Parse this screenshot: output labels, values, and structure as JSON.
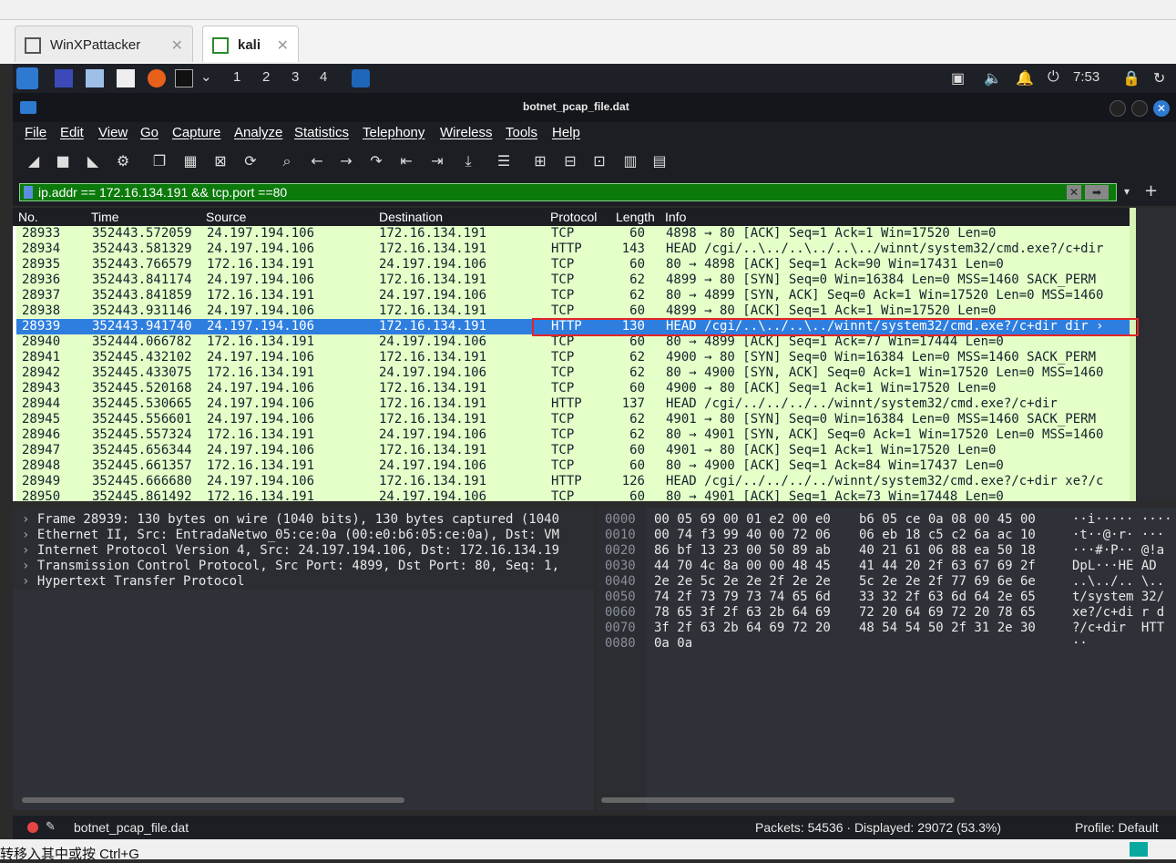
{
  "vm_tabs": [
    {
      "label": "WinXPattacker"
    },
    {
      "label": "kali"
    }
  ],
  "panel": {
    "workspaces": [
      "1",
      "2",
      "3",
      "4"
    ],
    "clock": "7:53"
  },
  "window": {
    "title": "botnet_pcap_file.dat"
  },
  "menu": {
    "items": [
      "File",
      "Edit",
      "View",
      "Go",
      "Capture",
      "Analyze",
      "Statistics",
      "Telephony",
      "Wireless",
      "Tools",
      "Help"
    ]
  },
  "filter": {
    "value": "ip.addr == 172.16.134.191 && tcp.port ==80"
  },
  "packet_list": {
    "columns": [
      "No.",
      "Time",
      "Source",
      "Destination",
      "Protocol",
      "Length",
      "Info"
    ],
    "rows": [
      {
        "no": "28933",
        "time": "352443.572059",
        "src": "24.197.194.106",
        "dst": "172.16.134.191",
        "proto": "TCP",
        "len": "60",
        "info": "4898 → 80 [ACK] Seq=1 Ack=1 Win=17520 Len=0"
      },
      {
        "no": "28934",
        "time": "352443.581329",
        "src": "24.197.194.106",
        "dst": "172.16.134.191",
        "proto": "HTTP",
        "len": "143",
        "info": "HEAD /cgi/..\\../..\\../..\\../winnt/system32/cmd.exe?/c+dir"
      },
      {
        "no": "28935",
        "time": "352443.766579",
        "src": "172.16.134.191",
        "dst": "24.197.194.106",
        "proto": "TCP",
        "len": "60",
        "info": "80 → 4898 [ACK] Seq=1 Ack=90 Win=17431 Len=0"
      },
      {
        "no": "28936",
        "time": "352443.841174",
        "src": "24.197.194.106",
        "dst": "172.16.134.191",
        "proto": "TCP",
        "len": "62",
        "info": "4899 → 80 [SYN] Seq=0 Win=16384 Len=0 MSS=1460 SACK_PERM"
      },
      {
        "no": "28937",
        "time": "352443.841859",
        "src": "172.16.134.191",
        "dst": "24.197.194.106",
        "proto": "TCP",
        "len": "62",
        "info": "80 → 4899 [SYN, ACK] Seq=0 Ack=1 Win=17520 Len=0 MSS=1460"
      },
      {
        "no": "28938",
        "time": "352443.931146",
        "src": "24.197.194.106",
        "dst": "172.16.134.191",
        "proto": "TCP",
        "len": "60",
        "info": "4899 → 80 [ACK] Seq=1 Ack=1 Win=17520 Len=0"
      },
      {
        "no": "28939",
        "time": "352443.941740",
        "src": "24.197.194.106",
        "dst": "172.16.134.191",
        "proto": "HTTP",
        "len": "130",
        "info": "HEAD /cgi/..\\../..\\../winnt/system32/cmd.exe?/c+dir dir ›"
      },
      {
        "no": "28940",
        "time": "352444.066782",
        "src": "172.16.134.191",
        "dst": "24.197.194.106",
        "proto": "TCP",
        "len": "60",
        "info": "80 → 4899 [ACK] Seq=1 Ack=77 Win=17444 Len=0"
      },
      {
        "no": "28941",
        "time": "352445.432102",
        "src": "24.197.194.106",
        "dst": "172.16.134.191",
        "proto": "TCP",
        "len": "62",
        "info": "4900 → 80 [SYN] Seq=0 Win=16384 Len=0 MSS=1460 SACK_PERM"
      },
      {
        "no": "28942",
        "time": "352445.433075",
        "src": "172.16.134.191",
        "dst": "24.197.194.106",
        "proto": "TCP",
        "len": "62",
        "info": "80 → 4900 [SYN, ACK] Seq=0 Ack=1 Win=17520 Len=0 MSS=1460"
      },
      {
        "no": "28943",
        "time": "352445.520168",
        "src": "24.197.194.106",
        "dst": "172.16.134.191",
        "proto": "TCP",
        "len": "60",
        "info": "4900 → 80 [ACK] Seq=1 Ack=1 Win=17520 Len=0"
      },
      {
        "no": "28944",
        "time": "352445.530665",
        "src": "24.197.194.106",
        "dst": "172.16.134.191",
        "proto": "HTTP",
        "len": "137",
        "info": "HEAD /cgi/../../../../winnt/system32/cmd.exe?/c+dir"
      },
      {
        "no": "28945",
        "time": "352445.556601",
        "src": "24.197.194.106",
        "dst": "172.16.134.191",
        "proto": "TCP",
        "len": "62",
        "info": "4901 → 80 [SYN] Seq=0 Win=16384 Len=0 MSS=1460 SACK_PERM"
      },
      {
        "no": "28946",
        "time": "352445.557324",
        "src": "172.16.134.191",
        "dst": "24.197.194.106",
        "proto": "TCP",
        "len": "62",
        "info": "80 → 4901 [SYN, ACK] Seq=0 Ack=1 Win=17520 Len=0 MSS=1460"
      },
      {
        "no": "28947",
        "time": "352445.656344",
        "src": "24.197.194.106",
        "dst": "172.16.134.191",
        "proto": "TCP",
        "len": "60",
        "info": "4901 → 80 [ACK] Seq=1 Ack=1 Win=17520 Len=0"
      },
      {
        "no": "28948",
        "time": "352445.661357",
        "src": "172.16.134.191",
        "dst": "24.197.194.106",
        "proto": "TCP",
        "len": "60",
        "info": "80 → 4900 [ACK] Seq=1 Ack=84 Win=17437 Len=0"
      },
      {
        "no": "28949",
        "time": "352445.666680",
        "src": "24.197.194.106",
        "dst": "172.16.134.191",
        "proto": "HTTP",
        "len": "126",
        "info": "HEAD /cgi/../../../../winnt/system32/cmd.exe?/c+dir xe?/c"
      },
      {
        "no": "28950",
        "time": "352445.861492",
        "src": "172.16.134.191",
        "dst": "24.197.194.106",
        "proto": "TCP",
        "len": "60",
        "info": "80 → 4901 [ACK] Seq=1 Ack=73 Win=17448 Len=0"
      }
    ]
  },
  "details": [
    "Frame 28939: 130 bytes on wire (1040 bits), 130 bytes captured (1040",
    "Ethernet II, Src: EntradaNetwo_05:ce:0a (00:e0:b6:05:ce:0a), Dst: VM",
    "Internet Protocol Version 4, Src: 24.197.194.106, Dst: 172.16.134.19",
    "Transmission Control Protocol, Src Port: 4899, Dst Port: 80, Seq: 1,",
    "Hypertext Transfer Protocol"
  ],
  "hex": [
    {
      "off": "0000",
      "a": "00 05 69 00 01 e2 00 e0",
      "b": "b6 05 ce 0a 08 00 45 00",
      "asc": "··i····· ····"
    },
    {
      "off": "0010",
      "a": "00 74 f3 99 40 00 72 06",
      "b": "06 eb 18 c5 c2 6a ac 10",
      "asc": "·t··@·r· ···"
    },
    {
      "off": "0020",
      "a": "86 bf 13 23 00 50 89 ab",
      "b": "40 21 61 06 88 ea 50 18",
      "asc": "···#·P·· @!a"
    },
    {
      "off": "0030",
      "a": "44 70 4c 8a 00 00 48 45",
      "b": "41 44 20 2f 63 67 69 2f",
      "asc": "DpL···HE AD"
    },
    {
      "off": "0040",
      "a": "2e 2e 5c 2e 2e 2f 2e 2e",
      "b": "5c 2e 2e 2f 77 69 6e 6e",
      "asc": "..\\../.. \\.."
    },
    {
      "off": "0050",
      "a": "74 2f 73 79 73 74 65 6d",
      "b": "33 32 2f 63 6d 64 2e 65",
      "asc": "t/system 32/"
    },
    {
      "off": "0060",
      "a": "78 65 3f 2f 63 2b 64 69",
      "b": "72 20 64 69 72 20 78 65",
      "asc": "xe?/c+di r d"
    },
    {
      "off": "0070",
      "a": "3f 2f 63 2b 64 69 72 20",
      "b": "48 54 54 50 2f 31 2e 30",
      "asc": "?/c+dir  HTT"
    },
    {
      "off": "0080",
      "a": "0a 0a",
      "b": "",
      "asc": "··"
    }
  ],
  "status": {
    "file": "botnet_pcap_file.dat",
    "packets": "Packets: 54536 · Displayed: 29072 (53.3%)",
    "profile": "Profile: Default"
  },
  "host_status": "转移入其中或按 Ctrl+G"
}
